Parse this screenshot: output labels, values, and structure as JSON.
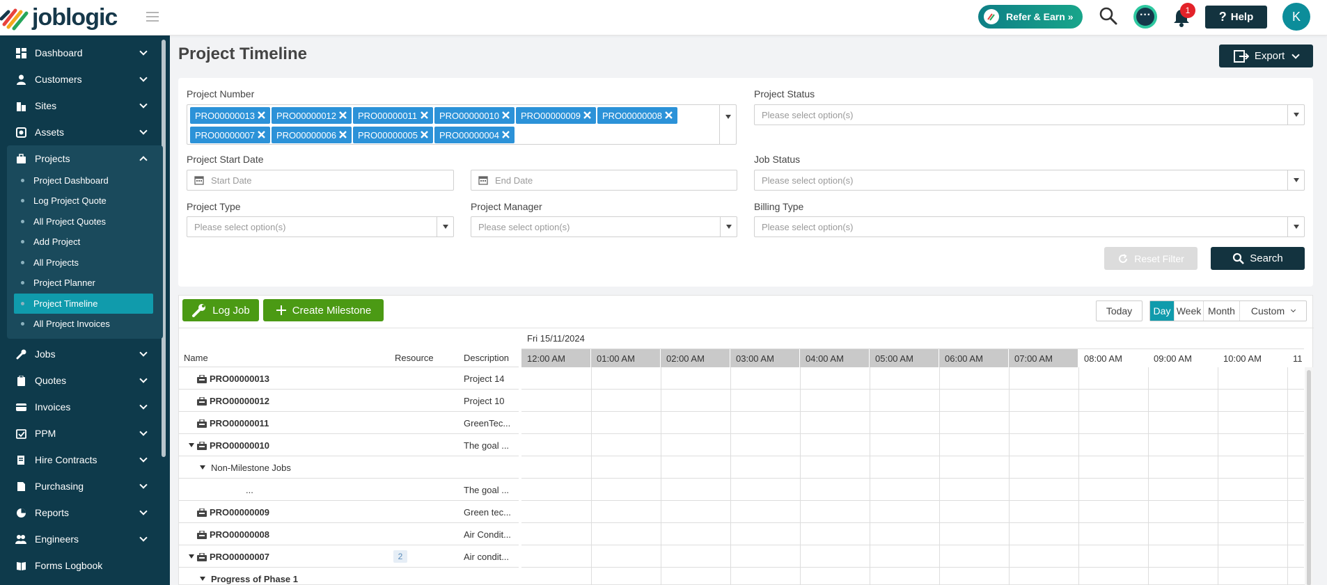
{
  "header": {
    "logo_text": "joblogic",
    "refer_label": "Refer & Earn »",
    "notification_count": "1",
    "help_label": "Help",
    "avatar_initial": "K"
  },
  "sidebar": {
    "items": [
      {
        "label": "Dashboard",
        "icon": "dashboard-icon"
      },
      {
        "label": "Customers",
        "icon": "user-icon"
      },
      {
        "label": "Sites",
        "icon": "building-icon"
      },
      {
        "label": "Assets",
        "icon": "asset-icon"
      },
      {
        "label": "Projects",
        "icon": "projects-icon"
      },
      {
        "label": "Jobs",
        "icon": "wrench-icon"
      },
      {
        "label": "Quotes",
        "icon": "clipboard-icon"
      },
      {
        "label": "Invoices",
        "icon": "card-icon"
      },
      {
        "label": "PPM",
        "icon": "calendar-check-icon"
      },
      {
        "label": "Hire Contracts",
        "icon": "contract-icon"
      },
      {
        "label": "Purchasing",
        "icon": "document-icon"
      },
      {
        "label": "Reports",
        "icon": "pie-chart-icon"
      },
      {
        "label": "Engineers",
        "icon": "engineers-icon"
      },
      {
        "label": "Forms Logbook",
        "icon": "book-icon"
      }
    ],
    "project_subitems": [
      "Project Dashboard",
      "Log Project Quote",
      "All Project Quotes",
      "Add Project",
      "All Projects",
      "Project Planner",
      "Project Timeline",
      "All Project Invoices"
    ],
    "active_subitem": "Project Timeline"
  },
  "page": {
    "title": "Project Timeline",
    "export_label": "Export"
  },
  "filters": {
    "project_number_label": "Project Number",
    "project_numbers": [
      "PRO00000013",
      "PRO00000012",
      "PRO00000011",
      "PRO00000010",
      "PRO00000009",
      "PRO00000008",
      "PRO00000007",
      "PRO00000006",
      "PRO00000005",
      "PRO00000004"
    ],
    "project_status_label": "Project Status",
    "project_status_placeholder": "Please select option(s)",
    "start_date_label": "Project Start Date",
    "start_date_placeholder": "Start Date",
    "end_date_placeholder": "End Date",
    "job_status_label": "Job Status",
    "job_status_placeholder": "Please select option(s)",
    "project_type_label": "Project Type",
    "project_type_placeholder": "Please select option(s)",
    "project_manager_label": "Project Manager",
    "project_manager_placeholder": "Please select option(s)",
    "billing_type_label": "Billing Type",
    "billing_type_placeholder": "Please select option(s)",
    "reset_label": "Reset Filter",
    "search_label": "Search"
  },
  "toolbar": {
    "log_job_label": "Log Job",
    "create_milestone_label": "Create Milestone",
    "today_label": "Today",
    "views": [
      "Day",
      "Week",
      "Month",
      "Custom"
    ],
    "active_view": "Day"
  },
  "timeline": {
    "columns": {
      "name": "Name",
      "resource": "Resource",
      "description": "Description"
    },
    "date": "Fri 15/11/2024",
    "hours": [
      "12:00 AM",
      "01:00 AM",
      "02:00 AM",
      "03:00 AM",
      "04:00 AM",
      "05:00 AM",
      "06:00 AM",
      "07:00 AM",
      "08:00 AM",
      "09:00 AM",
      "10:00 AM",
      "11"
    ],
    "rows": [
      {
        "name": "PRO00000013",
        "desc": "Project 14",
        "level": 0,
        "expand": false,
        "icon": true,
        "resource": ""
      },
      {
        "name": "PRO00000012",
        "desc": "Project 10",
        "level": 0,
        "expand": false,
        "icon": true,
        "resource": ""
      },
      {
        "name": "PRO00000011",
        "desc": "GreenTec...",
        "level": 0,
        "expand": false,
        "icon": true,
        "resource": ""
      },
      {
        "name": "PRO00000010",
        "desc": "The goal ...",
        "level": 0,
        "expand": true,
        "icon": true,
        "resource": ""
      },
      {
        "name": "Non-Milestone Jobs",
        "desc": "",
        "level": 1,
        "expand": true,
        "icon": false,
        "resource": ""
      },
      {
        "name": "...",
        "desc": "The goal ...",
        "level": 2,
        "expand": false,
        "icon": false,
        "resource": ""
      },
      {
        "name": "PRO00000009",
        "desc": "Green tec...",
        "level": 0,
        "expand": false,
        "icon": true,
        "resource": ""
      },
      {
        "name": "PRO00000008",
        "desc": "Air Condit...",
        "level": 0,
        "expand": false,
        "icon": true,
        "resource": ""
      },
      {
        "name": "PRO00000007",
        "desc": "Air condit...",
        "level": 0,
        "expand": true,
        "icon": true,
        "resource": "2"
      },
      {
        "name": "Progress of Phase 1",
        "desc": "",
        "level": 1,
        "expand": true,
        "icon": false,
        "resource": ""
      }
    ]
  }
}
